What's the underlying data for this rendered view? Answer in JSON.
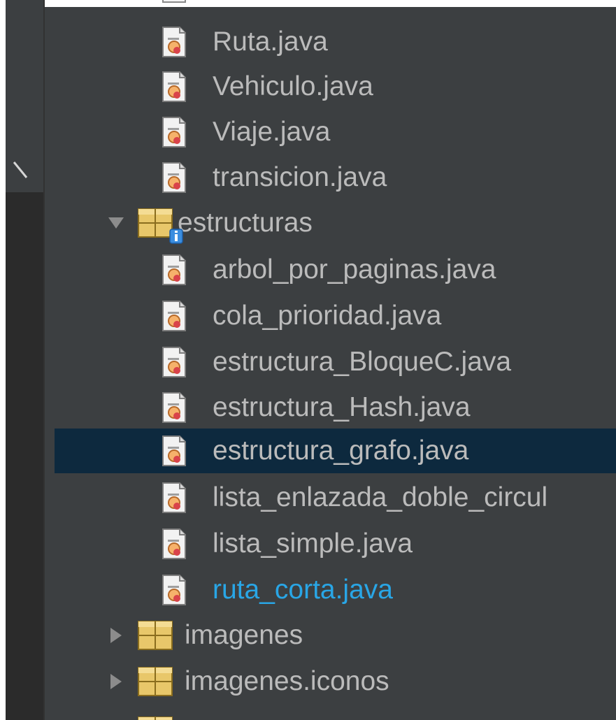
{
  "tree": {
    "items": [
      {
        "label": "Ruta.java",
        "icon": "java-file-icon",
        "kind": "file"
      },
      {
        "label": "Vehiculo.java",
        "icon": "java-file-icon",
        "kind": "file"
      },
      {
        "label": "Viaje.java",
        "icon": "java-file-icon",
        "kind": "file"
      },
      {
        "label": "transicion.java",
        "icon": "java-file-icon",
        "kind": "file"
      },
      {
        "label": "estructuras",
        "icon": "package-icon",
        "kind": "package",
        "expanded": true
      },
      {
        "label": "arbol_por_paginas.java",
        "icon": "java-file-icon",
        "kind": "file"
      },
      {
        "label": "cola_prioridad.java",
        "icon": "java-file-icon",
        "kind": "file"
      },
      {
        "label": "estructura_BloqueC.java",
        "icon": "java-file-icon",
        "kind": "file"
      },
      {
        "label": "estructura_Hash.java",
        "icon": "java-file-icon",
        "kind": "file"
      },
      {
        "label": "estructura_grafo.java",
        "icon": "java-file-icon",
        "kind": "file",
        "selected": true
      },
      {
        "label": "lista_enlazada_doble_circul",
        "icon": "java-file-icon",
        "kind": "file"
      },
      {
        "label": "lista_simple.java",
        "icon": "java-file-icon",
        "kind": "file"
      },
      {
        "label": "ruta_corta.java",
        "icon": "java-file-icon",
        "kind": "file",
        "modified": true
      },
      {
        "label": "imagenes",
        "icon": "package-icon",
        "kind": "package",
        "expanded": false
      },
      {
        "label": "imagenes.iconos",
        "icon": "package-icon",
        "kind": "package",
        "expanded": false
      }
    ]
  },
  "colors": {
    "background": "#3c3f41",
    "text": "#bbbbbb",
    "selection": "#0d293e",
    "modified_text": "#29a6e6",
    "package_folder": "#e8c76a"
  }
}
